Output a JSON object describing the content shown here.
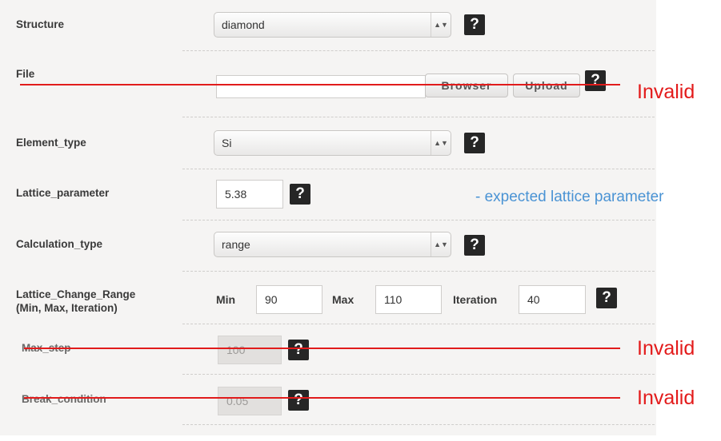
{
  "form": {
    "structure": {
      "label": "Structure",
      "value": "diamond"
    },
    "file": {
      "label": "File",
      "value": "",
      "browse_label": "Browser",
      "upload_label": "Upload"
    },
    "element_type": {
      "label": "Element_type",
      "value": "Si"
    },
    "lattice_parameter": {
      "label": "Lattice_parameter",
      "value": "5.38"
    },
    "calculation_type": {
      "label": "Calculation_type",
      "value": "range"
    },
    "lattice_change_range": {
      "label_line1": "Lattice_Change_Range",
      "label_line2": "(Min, Max, Iteration)",
      "min_label": "Min",
      "min_value": "90",
      "max_label": "Max",
      "max_value": "110",
      "iteration_label": "Iteration",
      "iteration_value": "40"
    },
    "max_step": {
      "label": "Max_step",
      "value": "100"
    },
    "break_condition": {
      "label": "Break_condition",
      "value": "0.05"
    },
    "help_symbol": "?",
    "select_arrows": "▲▼"
  },
  "annotations": {
    "invalid": "Invalid",
    "lattice_note": "- expected lattice parameter",
    "strike_color": "#e11b1b",
    "note_color": "#4a93d4"
  }
}
